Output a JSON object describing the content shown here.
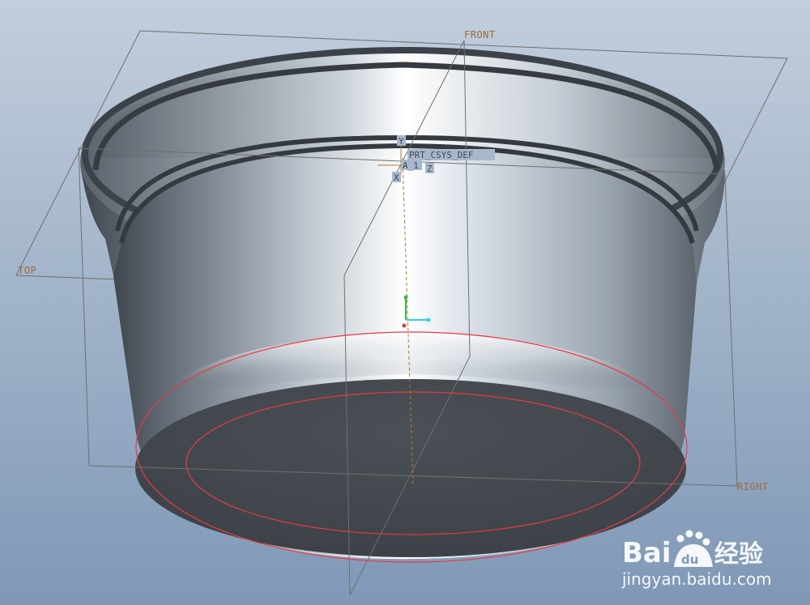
{
  "viewport": {
    "background_top": "#c2cedc",
    "background_bottom": "#7f98b6"
  },
  "datum_planes": {
    "front_label": "FRONT",
    "top_label": "TOP",
    "right_label": "RIGHT",
    "plane_color": "#6f6f6f",
    "label_color": "#9b6a3a"
  },
  "datum_axis": {
    "label": "A_1",
    "color": "#b4782f"
  },
  "coordinate_system": {
    "label": "PRT_CSYS_DEF",
    "axis_x_label": "X",
    "axis_y_label": "Y",
    "axis_z_label": "Z"
  },
  "sketch": {
    "color": "#e83a44"
  },
  "watermark": {
    "brand_latin": "Bai",
    "brand_paw": "du",
    "brand_cn": "经验",
    "url": "jingyan.baidu.com"
  }
}
